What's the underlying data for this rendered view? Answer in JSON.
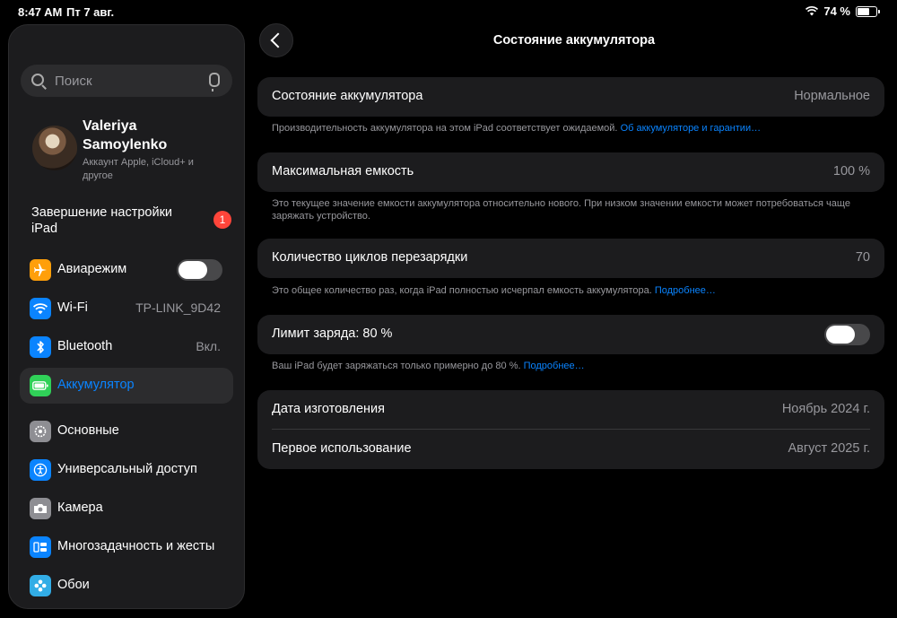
{
  "status_bar": {
    "time": "8:47 AM",
    "date": "Пт 7 авг.",
    "battery_percent_label": "74 %",
    "battery_level": 0.74
  },
  "sidebar": {
    "search_placeholder": "Поиск",
    "profile": {
      "name": "Valeriya Samoylenko",
      "subtitle": "Аккаунт Apple, iCloud+ и другое"
    },
    "setup": {
      "label": "Завершение настройки iPad",
      "badge": "1"
    },
    "items": [
      {
        "label": "Авиарежим",
        "icon": "airplane-icon",
        "color": "#ff9f0a",
        "toggle": false
      },
      {
        "label": "Wi-Fi",
        "icon": "wifi-icon",
        "color": "#0a84ff",
        "value": "TP-LINK_9D42"
      },
      {
        "label": "Bluetooth",
        "icon": "bluetooth-icon",
        "color": "#0a84ff",
        "value": "Вкл."
      },
      {
        "label": "Аккумулятор",
        "icon": "battery-icon",
        "color": "#30d158",
        "active": true
      },
      {
        "label": "Основные",
        "icon": "gear-icon",
        "color": "#8e8e93"
      },
      {
        "label": "Универсальный доступ",
        "icon": "accessibility-icon",
        "color": "#0a84ff"
      },
      {
        "label": "Камера",
        "icon": "camera-icon",
        "color": "#8e8e93"
      },
      {
        "label": "Многозадачность и жесты",
        "icon": "multitasking-icon",
        "color": "#0a84ff"
      },
      {
        "label": "Обои",
        "icon": "wallpaper-icon",
        "color": "#32ade6"
      }
    ]
  },
  "main": {
    "title": "Состояние аккумулятора",
    "health": {
      "label": "Состояние аккумулятора",
      "value": "Нормальное",
      "footer": "Производительность аккумулятора на этом iPad соответствует ожидаемой.",
      "footer_link": "Об аккумуляторе и гарантии…"
    },
    "capacity": {
      "label": "Максимальная емкость",
      "value": "100 %",
      "footer": "Это текущее значение емкости аккумулятора относительно нового. При низком значении емкости может потребоваться чаще заряжать устройство."
    },
    "cycles": {
      "label": "Количество циклов перезарядки",
      "value": "70",
      "footer": "Это общее количество раз, когда iPad полностью исчерпал емкость аккумулятора.",
      "footer_link": "Подробнее…"
    },
    "limit": {
      "label": "Лимит заряда: 80 %",
      "toggle": false,
      "footer": "Ваш iPad будет заряжаться только примерно до 80 %.",
      "footer_link": "Подробнее…"
    },
    "dates": {
      "manufacture_label": "Дата изготовления",
      "manufacture_value": "Ноябрь 2024 г.",
      "first_use_label": "Первое использование",
      "first_use_value": "Август 2025 г."
    }
  }
}
